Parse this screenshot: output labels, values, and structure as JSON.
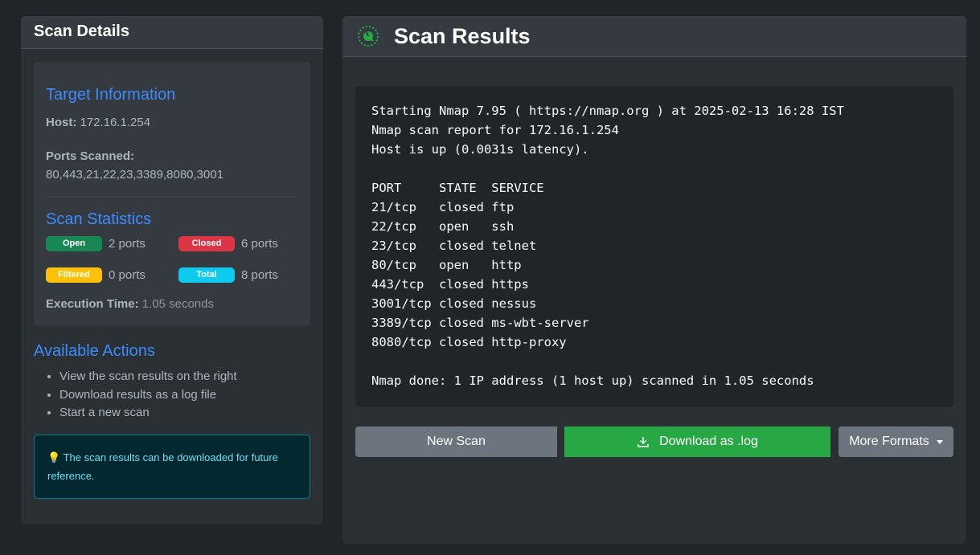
{
  "left": {
    "title": "Scan Details",
    "target_title": "Target Information",
    "host_label": "Host:",
    "host_value": "172.16.1.254",
    "ports_label": "Ports Scanned:",
    "ports_value": "80,443,21,22,23,3389,8080,3001",
    "stats_title": "Scan Statistics",
    "stats": [
      {
        "badge": "Open",
        "text": "2 ports",
        "color": "#198754"
      },
      {
        "badge": "Closed",
        "text": "6 ports",
        "color": "#dc3545"
      },
      {
        "badge": "Filtered",
        "text": "0 ports",
        "color": "#ffc107"
      },
      {
        "badge": "Total",
        "text": "8 ports",
        "color": "#0dcaf0"
      }
    ],
    "exec_label": "Execution Time:",
    "exec_value": "1.05 seconds",
    "actions_title": "Available Actions",
    "actions": [
      "View the scan results on the right",
      "Download results as a log file",
      "Start a new scan"
    ],
    "tip_icon": "lightbulb-icon",
    "tip_text": "The scan results can be downloaded for future reference."
  },
  "right": {
    "title": "Scan Results",
    "icon": "radar-icon",
    "output_lines": [
      "Starting Nmap 7.95 ( https://nmap.org ) at 2025-02-13 16:28 IST",
      "Nmap scan report for 172.16.1.254",
      "Host is up (0.0031s latency).",
      "",
      "PORT     STATE  SERVICE",
      "21/tcp   closed ftp",
      "22/tcp   open   ssh",
      "23/tcp   closed telnet",
      "80/tcp   open   http",
      "443/tcp  closed https",
      "3001/tcp closed nessus",
      "3389/tcp closed ms-wbt-server",
      "8080/tcp closed http-proxy",
      "",
      "Nmap done: 1 IP address (1 host up) scanned in 1.05 seconds"
    ],
    "buttons": {
      "new_scan": "New Scan",
      "download": "Download as .log",
      "more": "More Formats"
    }
  },
  "colors": {
    "accent_blue": "#3d8bfd",
    "download_green": "#28a745",
    "secondary_gray": "#6c757d"
  }
}
